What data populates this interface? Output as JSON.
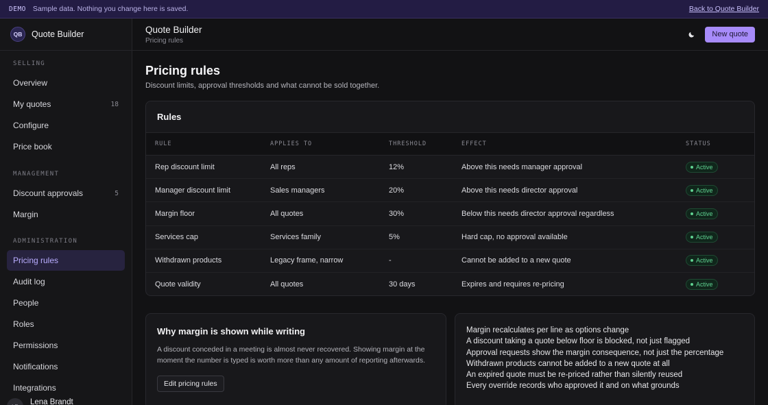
{
  "banner": {
    "tag": "DEMO",
    "message": "Sample data. Nothing you change here is saved.",
    "back_link": "Back to Quote Builder"
  },
  "brand": {
    "logo": "QB",
    "name": "Quote Builder"
  },
  "sidebar": {
    "sections": [
      {
        "label": "SELLING",
        "items": [
          {
            "label": "Overview",
            "count": ""
          },
          {
            "label": "My quotes",
            "count": "18"
          },
          {
            "label": "Configure",
            "count": ""
          },
          {
            "label": "Price book",
            "count": ""
          }
        ]
      },
      {
        "label": "MANAGEMENT",
        "items": [
          {
            "label": "Discount approvals",
            "count": "5"
          },
          {
            "label": "Margin",
            "count": ""
          }
        ]
      },
      {
        "label": "ADMINISTRATION",
        "items": [
          {
            "label": "Pricing rules",
            "count": "",
            "active": true
          },
          {
            "label": "Audit log",
            "count": ""
          },
          {
            "label": "People",
            "count": ""
          },
          {
            "label": "Roles",
            "count": ""
          },
          {
            "label": "Permissions",
            "count": ""
          },
          {
            "label": "Notifications",
            "count": ""
          },
          {
            "label": "Integrations",
            "count": ""
          }
        ]
      }
    ],
    "user": {
      "initials": "LB",
      "name": "Lena Brandt"
    }
  },
  "topbar": {
    "title": "Quote Builder",
    "subtitle": "Pricing rules",
    "new_quote": "New quote",
    "theme_icon": "moon-icon"
  },
  "page": {
    "title": "Pricing rules",
    "subtitle": "Discount limits, approval thresholds and what cannot be sold together."
  },
  "rules": {
    "title": "Rules",
    "columns": [
      "RULE",
      "APPLIES TO",
      "THRESHOLD",
      "EFFECT",
      "STATUS"
    ],
    "rows": [
      {
        "rule": "Rep discount limit",
        "applies": "All reps",
        "threshold": "12%",
        "effect": "Above this needs manager approval",
        "status": "Active"
      },
      {
        "rule": "Manager discount limit",
        "applies": "Sales managers",
        "threshold": "20%",
        "effect": "Above this needs director approval",
        "status": "Active"
      },
      {
        "rule": "Margin floor",
        "applies": "All quotes",
        "threshold": "30%",
        "effect": "Below this needs director approval regardless",
        "status": "Active"
      },
      {
        "rule": "Services cap",
        "applies": "Services family",
        "threshold": "5%",
        "effect": "Hard cap, no approval available",
        "status": "Active"
      },
      {
        "rule": "Withdrawn products",
        "applies": "Legacy frame, narrow",
        "threshold": "-",
        "effect": "Cannot be added to a new quote",
        "status": "Active"
      },
      {
        "rule": "Quote validity",
        "applies": "All quotes",
        "threshold": "30 days",
        "effect": "Expires and requires re-pricing",
        "status": "Active"
      }
    ]
  },
  "why": {
    "title": "Why margin is shown while writing",
    "body": "A discount conceded in a meeting is almost never recovered. Showing margin at the moment the number is typed is worth more than any amount of reporting afterwards.",
    "button": "Edit pricing rules"
  },
  "principles": [
    "Margin recalculates per line as options change",
    "A discount taking a quote below floor is blocked, not just flagged",
    "Approval requests show the margin consequence, not just the percentage",
    "Withdrawn products cannot be added to a new quote at all",
    "An expired quote must be re-priced rather than silently reused",
    "Every override records who approved it and on what grounds"
  ],
  "colors": {
    "accent": "#a78bfa",
    "active_bg": "#27233f",
    "status_green": "#5fd291",
    "banner_bg": "#231c44"
  }
}
